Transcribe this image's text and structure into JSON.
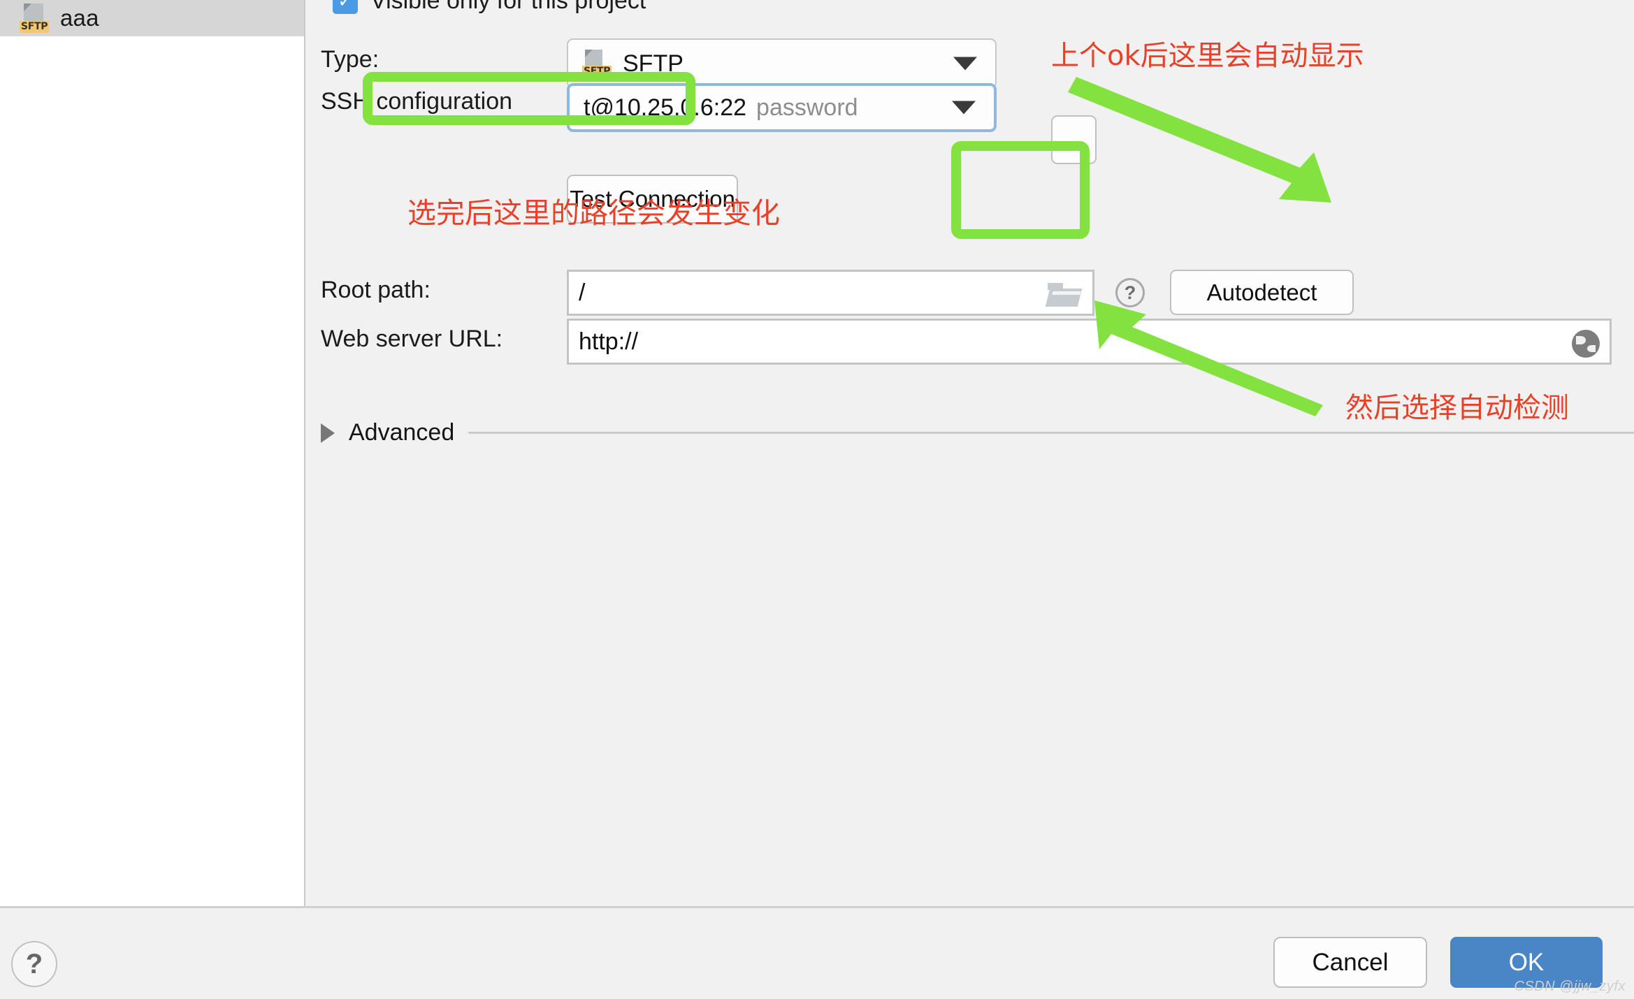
{
  "sidebar": {
    "items": [
      {
        "label": "aaa",
        "icon": "sftp-icon",
        "badge": "SFTP",
        "selected": true
      }
    ]
  },
  "main": {
    "visible_only_checkbox": {
      "label": "Visible only for this project",
      "checked": true,
      "check_glyph": "✓"
    },
    "type_row": {
      "label": "Type:",
      "value": "SFTP",
      "badge": "SFTP",
      "caret": "chevron-down-icon"
    },
    "ssh_configuration_row": {
      "label": "SSH configuration",
      "value": "t@10.25.0.6:22",
      "value_suffix": "password",
      "browse_button_label": "...",
      "caret": "chevron-down-icon"
    },
    "test_connection_button": {
      "label": "Test Connection"
    },
    "root_path_row": {
      "label": "Root path:",
      "value": "/",
      "browse_icon": "folder-icon",
      "help_icon": "question-circle-icon",
      "autodetect_button_label": "Autodetect"
    },
    "web_server_url_row": {
      "label": "Web server URL:",
      "value": "http://",
      "globe_icon": "globe-icon"
    },
    "advanced_section": {
      "label": "Advanced",
      "expanded": false,
      "arrow": "triangle-right-icon"
    }
  },
  "footer": {
    "help_button_label": "?",
    "cancel_button_label": "Cancel",
    "ok_button_label": "OK",
    "watermark": "CSDN @jjw_zyfx"
  },
  "annotations": {
    "color_red": "#e8412a",
    "color_green": "#83e23f",
    "note_top_right": "上个ok后这里会自动显示",
    "note_root_path": "选完后这里的路径会发生变化",
    "note_bottom_right": "然后选择自动检测"
  }
}
